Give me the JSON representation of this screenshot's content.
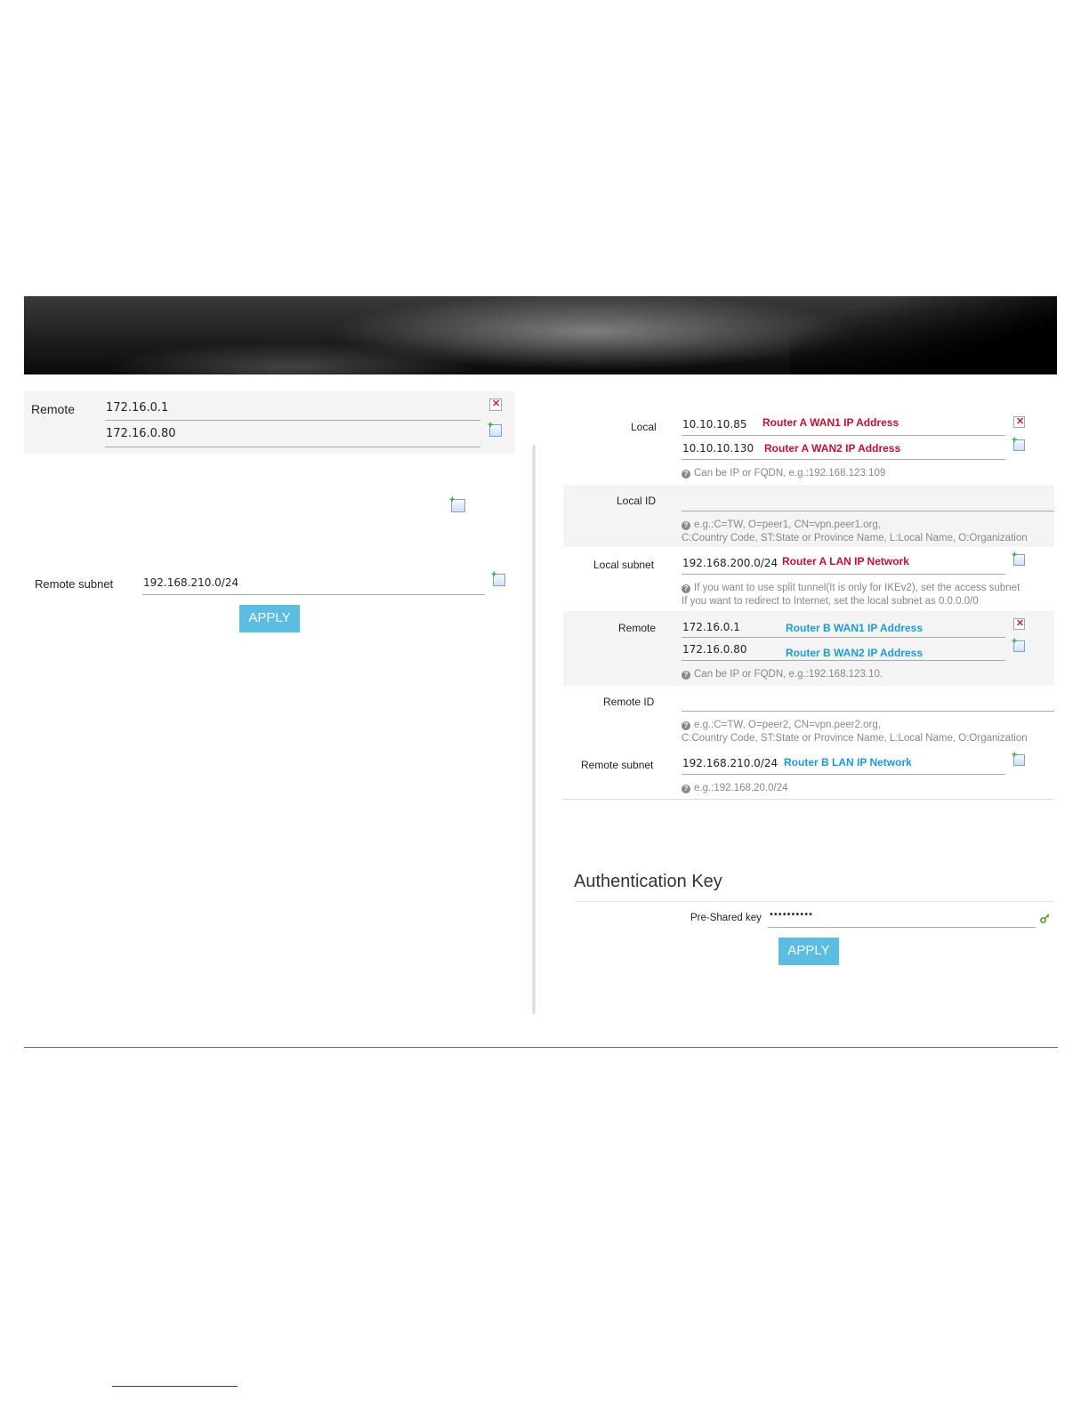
{
  "left_panel": {
    "remote_label": "Remote",
    "remote_values": [
      "172.16.0.1",
      "172.16.0.80"
    ],
    "remote_subnet_label": "Remote subnet",
    "remote_subnet_value": "192.168.210.0/24",
    "apply_label": "APPLY"
  },
  "right_panel": {
    "local_label": "Local",
    "local_values": [
      "10.10.10.85",
      "10.10.10.130"
    ],
    "local_annotations": [
      "Router A WAN1 IP Address",
      "Router A WAN2 IP Address"
    ],
    "local_hint": "Can be IP or FQDN, e.g.:192.168.123.109",
    "local_id_label": "Local ID",
    "local_id_hint_1": "e.g.:C=TW, O=peer1, CN=vpn.peer1.org,",
    "local_id_hint_2": "C:Country Code, ST:State or Province Name, L:Local Name, O:Organization",
    "local_subnet_label": "Local subnet",
    "local_subnet_value": "192.168.200.0/24",
    "local_subnet_annotation": "Router A LAN IP Network",
    "local_subnet_hint_1": "If you want to use split tunnel(It is only for IKEv2), set the access subnet",
    "local_subnet_hint_2": "If you want to redirect to Internet, set the local subnet as 0.0.0.0/0",
    "remote_label": "Remote",
    "remote_values": [
      "172.16.0.1",
      "172.16.0.80"
    ],
    "remote_annotations": [
      "Router B WAN1 IP Address",
      "Router B WAN2 IP Address"
    ],
    "remote_hint": "Can be IP or FQDN, e.g.:192.168.123.10.",
    "remote_id_label": "Remote ID",
    "remote_id_hint_1": "e.g.:C=TW, O=peer2, CN=vpn.peer2.org,",
    "remote_id_hint_2": "C:Country Code, ST:State or Province Name, L:Local Name, O:Organization",
    "remote_subnet_label": "Remote subnet",
    "remote_subnet_value": "192.168.210.0/24",
    "remote_subnet_annotation": "Router B LAN IP Network",
    "remote_subnet_hint": "e.g.:192.168.20.0/24",
    "auth_title": "Authentication Key",
    "psk_label": "Pre-Shared key",
    "psk_value": "••••••••••",
    "apply_label": "APPLY"
  },
  "colors": {
    "annotation_red": "#c8102e",
    "annotation_blue": "#1a9bd7",
    "apply_button": "#5bbde0",
    "rule_blue": "#4a78b8"
  },
  "icons": [
    "delete-icon",
    "add-icon",
    "help-icon",
    "key-icon"
  ]
}
